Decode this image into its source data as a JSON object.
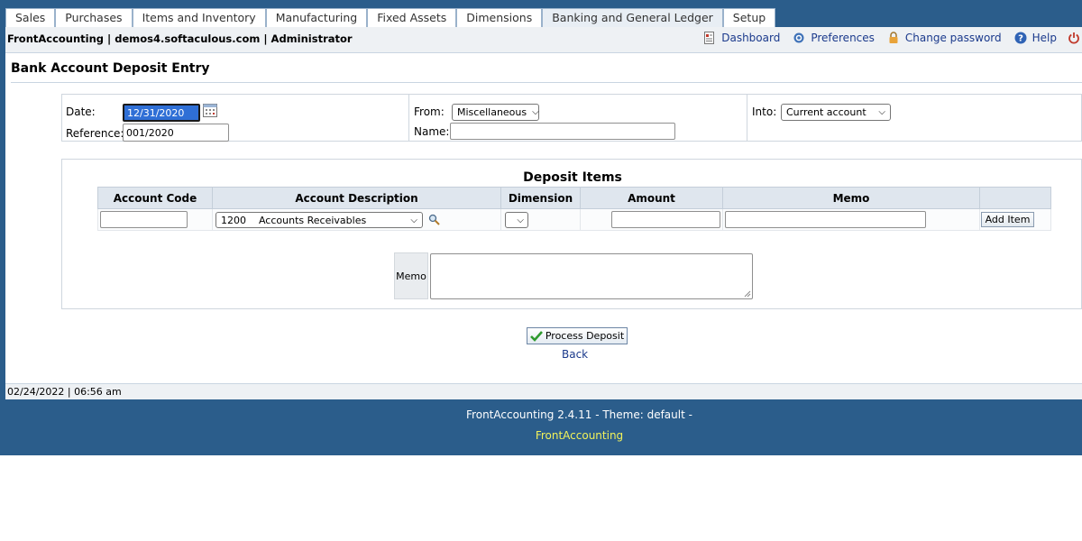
{
  "tabs": [
    {
      "label": "Sales"
    },
    {
      "label": "Purchases"
    },
    {
      "label": "Items and Inventory"
    },
    {
      "label": "Manufacturing"
    },
    {
      "label": "Fixed Assets"
    },
    {
      "label": "Dimensions"
    },
    {
      "label": "Banking and General Ledger",
      "active": true
    },
    {
      "label": "Setup"
    }
  ],
  "header": {
    "company": "FrontAccounting | demos4.softaculous.com | Administrator",
    "links": {
      "dashboard": "Dashboard",
      "preferences": "Preferences",
      "change_password": "Change password",
      "help": "Help"
    }
  },
  "page": {
    "title": "Bank Account Deposit Entry"
  },
  "form": {
    "date_label": "Date:",
    "date_value": "12/31/2020",
    "reference_label": "Reference:",
    "reference_value": "001/2020",
    "from_label": "From:",
    "from_value": "Miscellaneous",
    "name_label": "Name:",
    "name_value": "",
    "into_label": "Into:",
    "into_value": "Current account"
  },
  "items": {
    "title": "Deposit Items",
    "columns": {
      "account_code": "Account Code",
      "account_description": "Account Description",
      "dimension": "Dimension",
      "amount": "Amount",
      "memo": "Memo"
    },
    "row": {
      "account_code": "",
      "account_description": "1200    Accounts Receivables",
      "dimension": "",
      "amount": "",
      "memo": ""
    },
    "add_button": "Add Item"
  },
  "memo": {
    "label": "Memo",
    "value": ""
  },
  "actions": {
    "process_label": "Process Deposit",
    "back_label": "Back"
  },
  "status": {
    "datetime": "02/24/2022 | 06:56 am"
  },
  "footer": {
    "version": "FrontAccounting 2.4.11 - Theme: default -",
    "link": "FrontAccounting"
  },
  "colors": {
    "frame": "#2b5d8b",
    "link": "#1b3a8c",
    "footer_link": "#f2f25a"
  }
}
